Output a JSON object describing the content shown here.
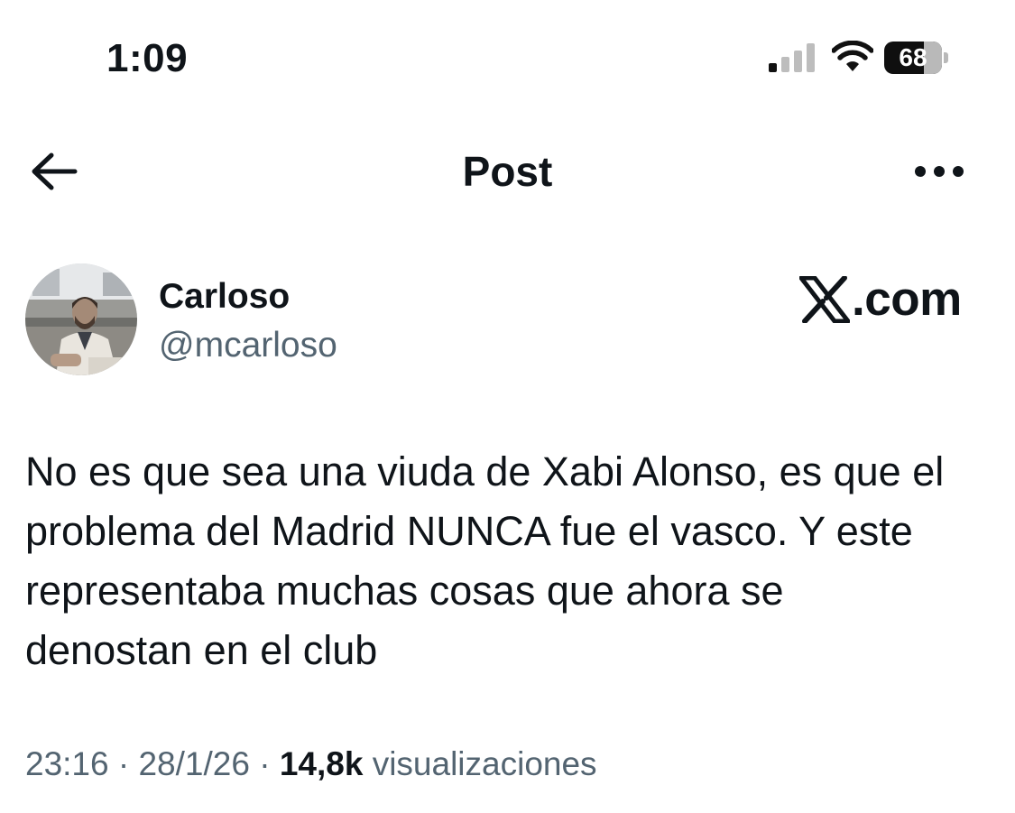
{
  "status_bar": {
    "time": "1:09",
    "battery_percent": 68,
    "battery_label": "68",
    "icons": [
      "cellular-signal-icon",
      "wifi-icon",
      "battery-icon"
    ]
  },
  "header": {
    "title": "Post",
    "back_icon": "arrow-left-icon",
    "more_icon": "more-horizontal-icon"
  },
  "post": {
    "author": {
      "display_name": "Carloso",
      "handle": "@mcarloso",
      "avatar": "profile-photo"
    },
    "source_mark": ".com",
    "text": "No es que sea una viuda de Xabi Alonso, es que el\nproblema del Madrid NUNCA fue el vasco. Y este\nrepresentaba muchas cosas que ahora se\ndenostan en el club",
    "time": "23:16",
    "date": "28/1/26",
    "separator": " · ",
    "views_count": "14,8k",
    "views_label": "visualizaciones"
  },
  "colors": {
    "text_primary": "#0f1419",
    "text_secondary": "#536471",
    "background": "#ffffff"
  }
}
